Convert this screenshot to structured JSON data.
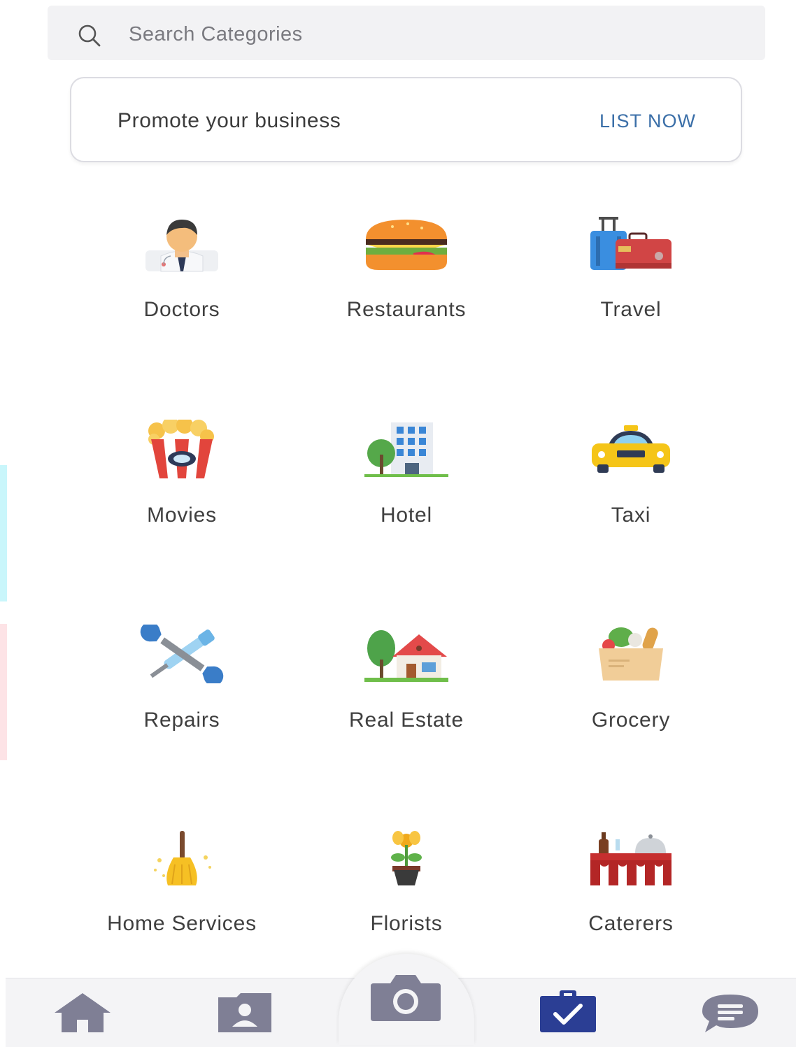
{
  "search": {
    "placeholder": "Search Categories",
    "icon": "search-icon"
  },
  "promo": {
    "text": "Promote your business",
    "cta": "LIST NOW",
    "cta_color": "#3b6fa8"
  },
  "categories": [
    {
      "label": "Doctors",
      "icon": "doctor-icon"
    },
    {
      "label": "Restaurants",
      "icon": "burger-icon"
    },
    {
      "label": "Travel",
      "icon": "luggage-icon"
    },
    {
      "label": "Movies",
      "icon": "popcorn-icon"
    },
    {
      "label": "Hotel",
      "icon": "hotel-building-icon"
    },
    {
      "label": "Taxi",
      "icon": "taxi-icon"
    },
    {
      "label": "Repairs",
      "icon": "wrench-screwdriver-icon"
    },
    {
      "label": "Real Estate",
      "icon": "house-icon"
    },
    {
      "label": "Grocery",
      "icon": "grocery-bag-icon"
    },
    {
      "label": "Home Services",
      "icon": "broom-icon"
    },
    {
      "label": "Florists",
      "icon": "flower-pot-icon"
    },
    {
      "label": "Caterers",
      "icon": "catering-table-icon"
    }
  ],
  "bottom_nav": [
    {
      "icon": "home-icon"
    },
    {
      "icon": "contact-card-icon"
    },
    {
      "icon": "camera-icon"
    },
    {
      "icon": "clipboard-check-icon",
      "active_color": "#2b3e94"
    },
    {
      "icon": "chat-bubble-icon"
    }
  ],
  "colors": {
    "nav_icon": "#7f7f95",
    "nav_active": "#2b3e94",
    "label": "#3f3f3f"
  }
}
